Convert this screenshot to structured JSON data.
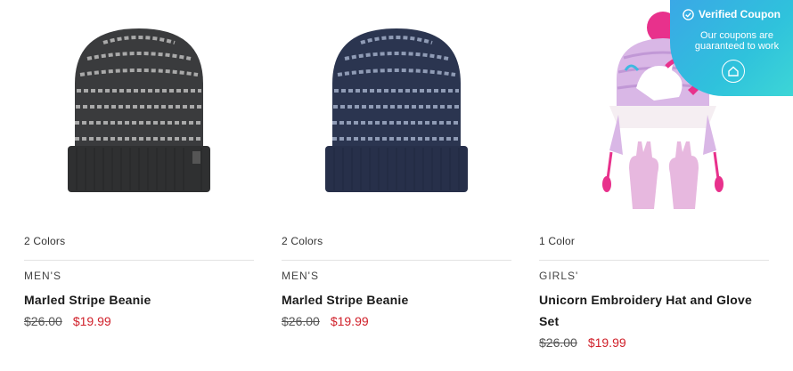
{
  "products": [
    {
      "colors": "2 Colors",
      "category": "MEN'S",
      "name": "Marled Stripe Beanie",
      "price_old": "$26.00",
      "price_new": "$19.99",
      "image": "charcoal-striped-beanie"
    },
    {
      "colors": "2 Colors",
      "category": "MEN'S",
      "name": "Marled Stripe Beanie",
      "price_old": "$26.00",
      "price_new": "$19.99",
      "image": "navy-striped-beanie"
    },
    {
      "colors": "1 Color",
      "category": "GIRLS'",
      "name": "Unicorn Embroidery Hat and Glove Set",
      "price_old": "$26.00",
      "price_new": "$19.99",
      "image": "pink-unicorn-hat-and-gloves"
    }
  ],
  "coupon": {
    "title": "Verified Coupon",
    "subtitle": "Our coupons are guaranteed to work",
    "icon": "check-circle-icon",
    "logo": "home-logo-icon",
    "colors": {
      "from": "#3aa8e6",
      "to": "#3dd6d6"
    }
  },
  "colors": {
    "sale_price": "#d0202a",
    "divider": "#e3e3e3"
  }
}
